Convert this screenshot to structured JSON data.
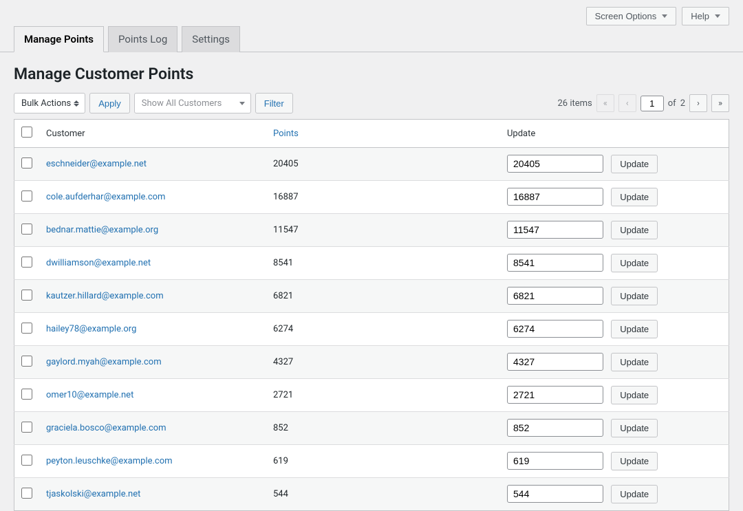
{
  "top": {
    "screen_options": "Screen Options",
    "help": "Help"
  },
  "tabs": {
    "manage_points": "Manage Points",
    "points_log": "Points Log",
    "settings": "Settings"
  },
  "page_title": "Manage Customer Points",
  "bulk_actions_label": "Bulk Actions",
  "apply_button": "Apply",
  "customer_filter_placeholder": "Show All Customers",
  "filter_button": "Filter",
  "pagination": {
    "items_label": "26 items",
    "current_page": "1",
    "total_pages": "2",
    "of_label": "of"
  },
  "columns": {
    "customer": "Customer",
    "points": "Points",
    "update": "Update"
  },
  "update_button": "Update",
  "rows": [
    {
      "customer": "eschneider@example.net",
      "points": "20405",
      "input": "20405"
    },
    {
      "customer": "cole.aufderhar@example.com",
      "points": "16887",
      "input": "16887"
    },
    {
      "customer": "bednar.mattie@example.org",
      "points": "11547",
      "input": "11547"
    },
    {
      "customer": "dwilliamson@example.net",
      "points": "8541",
      "input": "8541"
    },
    {
      "customer": "kautzer.hillard@example.com",
      "points": "6821",
      "input": "6821"
    },
    {
      "customer": "hailey78@example.org",
      "points": "6274",
      "input": "6274"
    },
    {
      "customer": "gaylord.myah@example.com",
      "points": "4327",
      "input": "4327"
    },
    {
      "customer": "omer10@example.net",
      "points": "2721",
      "input": "2721"
    },
    {
      "customer": "graciela.bosco@example.com",
      "points": "852",
      "input": "852"
    },
    {
      "customer": "peyton.leuschke@example.com",
      "points": "619",
      "input": "619"
    },
    {
      "customer": "tjaskolski@example.net",
      "points": "544",
      "input": "544"
    }
  ]
}
